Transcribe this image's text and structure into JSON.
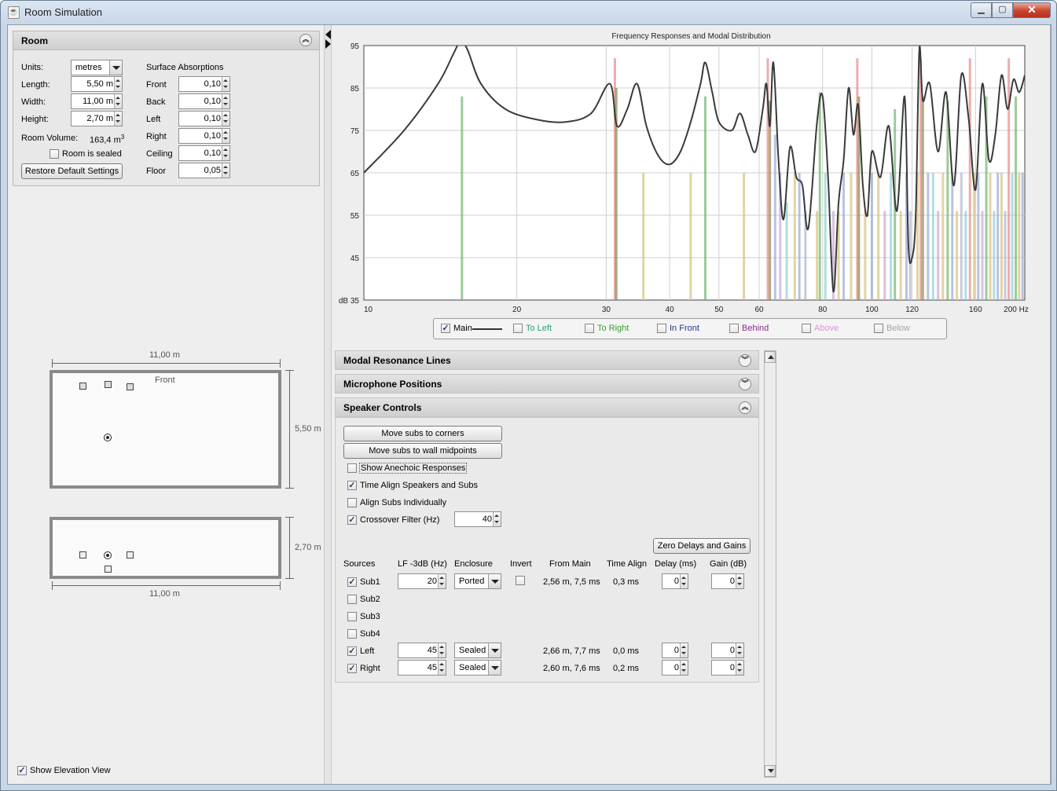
{
  "window": {
    "title": "Room Simulation",
    "close_glyph": "✕"
  },
  "room": {
    "header": "Room",
    "units_label": "Units:",
    "units_value": "metres",
    "length_label": "Length:",
    "length_value": "5,50 m",
    "width_label": "Width:",
    "width_value": "11,00 m",
    "height_label": "Height:",
    "height_value": "2,70 m",
    "volume_label": "Room Volume:",
    "volume_value": "163,4 m",
    "volume_unit_sup": "3",
    "sealed_label": "Room is sealed",
    "sealed_checked": false,
    "restore_label": "Restore Default Settings",
    "absorptions_header": "Surface Absorptions",
    "absorptions": [
      {
        "label": "Front",
        "value": "0,10"
      },
      {
        "label": "Back",
        "value": "0,10"
      },
      {
        "label": "Left",
        "value": "0,10"
      },
      {
        "label": "Right",
        "value": "0,10"
      },
      {
        "label": "Ceiling",
        "value": "0,10"
      },
      {
        "label": "Floor",
        "value": "0,05"
      }
    ]
  },
  "plan": {
    "top_width_label": "11,00 m",
    "front_label": "Front",
    "depth_label": "5,50 m",
    "elevation_height_label": "2,70 m",
    "elevation_width_label": "11,00 m"
  },
  "show_elevation_label": "Show Elevation View",
  "show_elevation_checked": true,
  "chart_data": {
    "type": "line",
    "title": "Frequency Responses and Modal Distribution",
    "x_scale": "log",
    "xlim": [
      10,
      200
    ],
    "ylim": [
      35,
      95
    ],
    "x_ticks": [
      "10",
      "20",
      "30",
      "40",
      "50",
      "60",
      "80",
      "100",
      "120",
      "160",
      "200 Hz"
    ],
    "x_tick_values": [
      10,
      20,
      30,
      40,
      50,
      60,
      80,
      100,
      120,
      160,
      200
    ],
    "y_ticks": [
      "95",
      "85",
      "75",
      "65",
      "55",
      "45",
      "dB 35"
    ],
    "y_tick_values": [
      95,
      85,
      75,
      65,
      55,
      45,
      35
    ],
    "grid": true,
    "series": [
      {
        "name": "Main",
        "color": "#3a3a3a",
        "x": [
          10,
          12,
          14,
          15,
          15.5,
          16,
          17,
          19,
          22,
          25,
          28,
          30.5,
          31.5,
          33,
          34.5,
          36,
          38,
          40,
          42,
          44,
          46,
          47,
          48.5,
          50,
          53,
          55,
          57,
          59,
          61,
          62,
          63,
          64,
          65.5,
          67,
          69,
          71,
          73,
          75,
          78,
          80,
          82,
          84,
          86,
          88,
          90,
          92,
          94,
          96,
          98,
          100,
          104,
          108,
          112,
          116,
          118,
          120,
          122,
          124,
          126,
          130,
          135,
          140,
          145,
          150,
          155,
          160,
          165,
          170,
          175,
          180,
          185,
          190,
          195,
          200
        ],
        "y": [
          65,
          75,
          86,
          93,
          96,
          94,
          86,
          80,
          77.5,
          77,
          79,
          86,
          76,
          80,
          86,
          76,
          69,
          67,
          70,
          77,
          86,
          91,
          84,
          77,
          75,
          79,
          74,
          70,
          80,
          86,
          76,
          91,
          68,
          54,
          71,
          64,
          62,
          52,
          77,
          83,
          64,
          37,
          58,
          68,
          85,
          74,
          81,
          62,
          55,
          70,
          64,
          76,
          56,
          83,
          48,
          45,
          55,
          94,
          82,
          86,
          70,
          84,
          62,
          88,
          78,
          61,
          86,
          68,
          74,
          88,
          80,
          87,
          84,
          88
        ]
      },
      {
        "name": "To Left",
        "color": "#2aa07a"
      },
      {
        "name": "To Right",
        "color": "#3b9a3b"
      },
      {
        "name": "In Front",
        "color": "#23368f"
      },
      {
        "name": "Behind",
        "color": "#8a2d8e"
      },
      {
        "name": "Above",
        "color": "#d992d6"
      },
      {
        "name": "Below",
        "color": "#a5a5a5"
      }
    ],
    "modal_lines": [
      {
        "f": 15.6,
        "top": 83,
        "color": "#6fb56f"
      },
      {
        "f": 31.2,
        "top": 92,
        "color": "#e58a8a"
      },
      {
        "f": 31.4,
        "top": 85,
        "color": "#8c8c50"
      },
      {
        "f": 35.5,
        "top": 65,
        "color": "#d6c27a"
      },
      {
        "f": 44,
        "top": 65,
        "color": "#d6c27a"
      },
      {
        "f": 47,
        "top": 83,
        "color": "#6fb56f"
      },
      {
        "f": 56,
        "top": 65,
        "color": "#d6c27a"
      },
      {
        "f": 62.4,
        "top": 92,
        "color": "#e58a8a"
      },
      {
        "f": 63,
        "top": 82,
        "color": "#8c8c50"
      },
      {
        "f": 64.5,
        "top": 74,
        "color": "#9aaad6"
      },
      {
        "f": 66,
        "top": 65,
        "color": "#c7a7d6"
      },
      {
        "f": 68,
        "top": 58,
        "color": "#8ecfd6"
      },
      {
        "f": 70.5,
        "top": 65,
        "color": "#d6c27a"
      },
      {
        "f": 72,
        "top": 65,
        "color": "#9aaad6"
      },
      {
        "f": 74,
        "top": 56,
        "color": "#b2b2cc"
      },
      {
        "f": 78,
        "top": 56,
        "color": "#d6c27a"
      },
      {
        "f": 79,
        "top": 84,
        "color": "#6fb56f"
      },
      {
        "f": 81,
        "top": 65,
        "color": "#8ecfd6"
      },
      {
        "f": 84,
        "top": 56,
        "color": "#c7a7d6"
      },
      {
        "f": 86,
        "top": 56,
        "color": "#d6c27a"
      },
      {
        "f": 88,
        "top": 65,
        "color": "#9aaad6"
      },
      {
        "f": 91,
        "top": 65,
        "color": "#d6c27a"
      },
      {
        "f": 93.6,
        "top": 92,
        "color": "#e58a8a"
      },
      {
        "f": 94.3,
        "top": 83,
        "color": "#8c8c50"
      },
      {
        "f": 97,
        "top": 56,
        "color": "#d6c27a"
      },
      {
        "f": 100,
        "top": 65,
        "color": "#9aaad6"
      },
      {
        "f": 103,
        "top": 65,
        "color": "#d6c27a"
      },
      {
        "f": 106,
        "top": 56,
        "color": "#c7a7d6"
      },
      {
        "f": 109,
        "top": 65,
        "color": "#8ecfd6"
      },
      {
        "f": 111,
        "top": 80,
        "color": "#6fb56f"
      },
      {
        "f": 114,
        "top": 56,
        "color": "#d6c27a"
      },
      {
        "f": 117,
        "top": 65,
        "color": "#9aaad6"
      },
      {
        "f": 119,
        "top": 56,
        "color": "#b2b2cc"
      },
      {
        "f": 123,
        "top": 65,
        "color": "#d6c27a"
      },
      {
        "f": 124.8,
        "top": 92,
        "color": "#e58a8a"
      },
      {
        "f": 126,
        "top": 83,
        "color": "#8c8c50"
      },
      {
        "f": 129,
        "top": 65,
        "color": "#9aaad6"
      },
      {
        "f": 132,
        "top": 65,
        "color": "#8ecfd6"
      },
      {
        "f": 135,
        "top": 56,
        "color": "#c7a7d6"
      },
      {
        "f": 138,
        "top": 65,
        "color": "#d6c27a"
      },
      {
        "f": 141,
        "top": 82,
        "color": "#6fb56f"
      },
      {
        "f": 144,
        "top": 65,
        "color": "#9aaad6"
      },
      {
        "f": 147,
        "top": 56,
        "color": "#d6c27a"
      },
      {
        "f": 150,
        "top": 65,
        "color": "#b2b2cc"
      },
      {
        "f": 153,
        "top": 56,
        "color": "#8ecfd6"
      },
      {
        "f": 156,
        "top": 92,
        "color": "#e58a8a"
      },
      {
        "f": 159,
        "top": 65,
        "color": "#d6c27a"
      },
      {
        "f": 162,
        "top": 65,
        "color": "#9aaad6"
      },
      {
        "f": 165,
        "top": 56,
        "color": "#c7a7d6"
      },
      {
        "f": 168,
        "top": 83,
        "color": "#6fb56f"
      },
      {
        "f": 171,
        "top": 65,
        "color": "#d6c27a"
      },
      {
        "f": 174,
        "top": 56,
        "color": "#8ecfd6"
      },
      {
        "f": 177,
        "top": 65,
        "color": "#9aaad6"
      },
      {
        "f": 180,
        "top": 65,
        "color": "#d6c27a"
      },
      {
        "f": 183,
        "top": 56,
        "color": "#b2b2cc"
      },
      {
        "f": 186,
        "top": 92,
        "color": "#e58a8a"
      },
      {
        "f": 189,
        "top": 65,
        "color": "#8ecfd6"
      },
      {
        "f": 192,
        "top": 83,
        "color": "#6fb56f"
      },
      {
        "f": 195,
        "top": 65,
        "color": "#d6c27a"
      },
      {
        "f": 198,
        "top": 65,
        "color": "#9aaad6"
      }
    ]
  },
  "legend": {
    "items": [
      {
        "label": "Main",
        "checked": true,
        "color": "#000000"
      },
      {
        "label": "To Left",
        "checked": false,
        "color": "#2aa07a"
      },
      {
        "label": "To Right",
        "checked": false,
        "color": "#3b9a3b"
      },
      {
        "label": "In Front",
        "checked": false,
        "color": "#23368f"
      },
      {
        "label": "Behind",
        "checked": false,
        "color": "#8a2d8e"
      },
      {
        "label": "Above",
        "checked": false,
        "color": "#d992d6"
      },
      {
        "label": "Below",
        "checked": false,
        "color": "#a5a5a5"
      }
    ]
  },
  "sections": {
    "modal": "Modal Resonance Lines",
    "mic": "Microphone Positions",
    "speaker": "Speaker Controls"
  },
  "speaker": {
    "move_corners": "Move subs to corners",
    "move_midpoints": "Move subs to wall midpoints",
    "anechoic_label": "Show Anechoic Responses",
    "anechoic_checked": false,
    "time_align_label": "Time Align Speakers and Subs",
    "time_align_checked": true,
    "align_individually_label": "Align Subs Individually",
    "align_individually_checked": false,
    "crossover_label": "Crossover Filter (Hz)",
    "crossover_checked": true,
    "crossover_value": "40",
    "zero_label": "Zero Delays and Gains",
    "headers": {
      "sources": "Sources",
      "lf": "LF -3dB (Hz)",
      "enclosure": "Enclosure",
      "invert": "Invert",
      "from_main": "From Main",
      "time_align": "Time Align",
      "delay": "Delay (ms)",
      "gain": "Gain (dB)"
    },
    "rows": [
      {
        "name": "Sub1",
        "checked": true,
        "lf": "20",
        "enclosure": "Ported",
        "invert": false,
        "from_main": "2,56 m, 7,5 ms",
        "time_align": "0,3 ms",
        "delay": "0",
        "gain": "0",
        "active": true,
        "show_invert": true
      },
      {
        "name": "Sub2",
        "checked": false,
        "active": false
      },
      {
        "name": "Sub3",
        "checked": false,
        "active": false
      },
      {
        "name": "Sub4",
        "checked": false,
        "active": false
      },
      {
        "name": "Left",
        "checked": true,
        "lf": "45",
        "enclosure": "Sealed",
        "from_main": "2,66 m, 7,7 ms",
        "time_align": "0,0 ms",
        "delay": "0",
        "gain": "0",
        "active": true,
        "show_invert": false
      },
      {
        "name": "Right",
        "checked": true,
        "lf": "45",
        "enclosure": "Sealed",
        "from_main": "2,60 m, 7,6 ms",
        "time_align": "0,2 ms",
        "delay": "0",
        "gain": "0",
        "active": true,
        "show_invert": false
      }
    ]
  }
}
